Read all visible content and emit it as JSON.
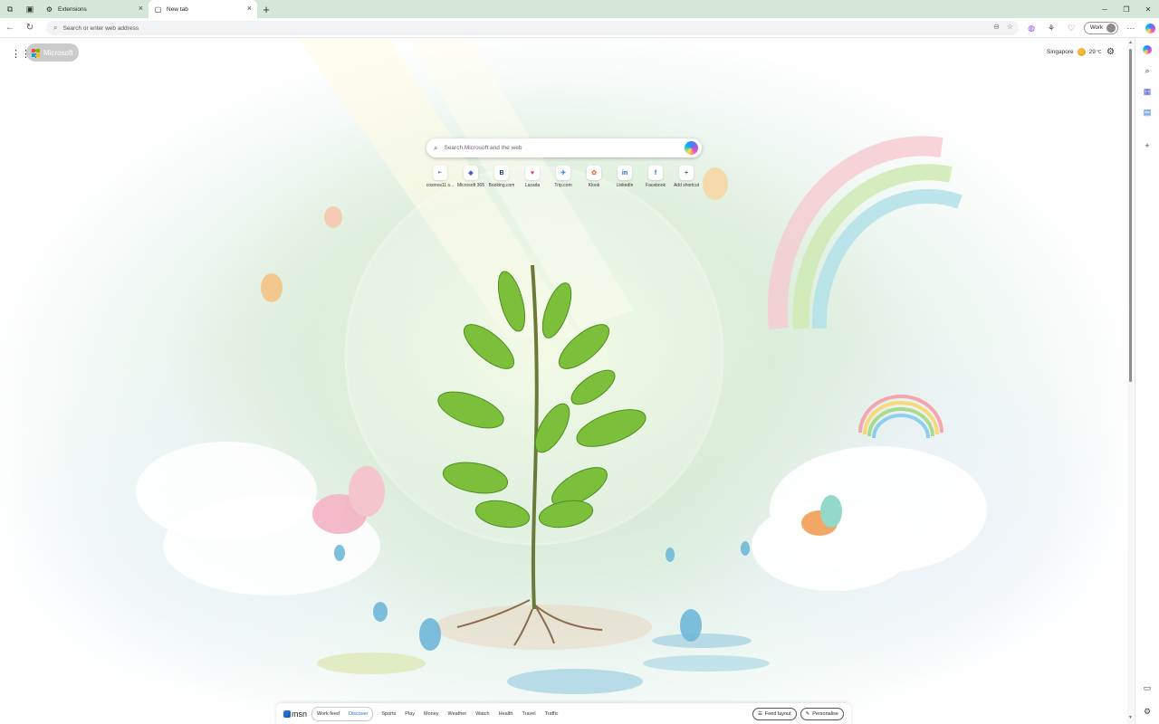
{
  "tabs": [
    {
      "title": "Extensions",
      "icon": "extensions-gear-icon"
    },
    {
      "title": "New tab",
      "icon": "newtab-page-icon"
    }
  ],
  "address_bar": {
    "placeholder": "Search or enter web address"
  },
  "profile": {
    "label": "Work"
  },
  "page": {
    "brand": "Microsoft",
    "weather": {
      "city": "Singapore",
      "temp": "29",
      "unit": "°C"
    },
    "search_placeholder": "Search Microsoft and the web",
    "shortcuts": [
      {
        "label": "cosmos11 s...",
        "glyph": "•·",
        "color": "#3a6fd8"
      },
      {
        "label": "Microsoft 365",
        "glyph": "◆",
        "color": "#4a5de0"
      },
      {
        "label": "Booking.com",
        "glyph": "B",
        "color": "#0b3a82"
      },
      {
        "label": "Lazada",
        "glyph": "♥",
        "color": "#e8345d"
      },
      {
        "label": "Trip.com",
        "glyph": "✈",
        "color": "#287dfa"
      },
      {
        "label": "Klook",
        "glyph": "✿",
        "color": "#ff6a3d"
      },
      {
        "label": "LinkedIn",
        "glyph": "in",
        "color": "#0a66c2"
      },
      {
        "label": "Facebook",
        "glyph": "f",
        "color": "#1877f2"
      },
      {
        "label": "Add shortcut",
        "glyph": "+",
        "color": "#555555"
      }
    ]
  },
  "feed": {
    "brand": "msn",
    "group_tabs": [
      "Work feed",
      "Discover"
    ],
    "tabs": [
      "Sports",
      "Play",
      "Money",
      "Weather",
      "Watch",
      "Health",
      "Travel",
      "Traffic"
    ],
    "buttons": {
      "layout": "Feed layout",
      "personalise": "Personalise"
    }
  },
  "colors": {
    "tab_strip": "#d4e7d9",
    "accent": "#1a6fd6"
  }
}
